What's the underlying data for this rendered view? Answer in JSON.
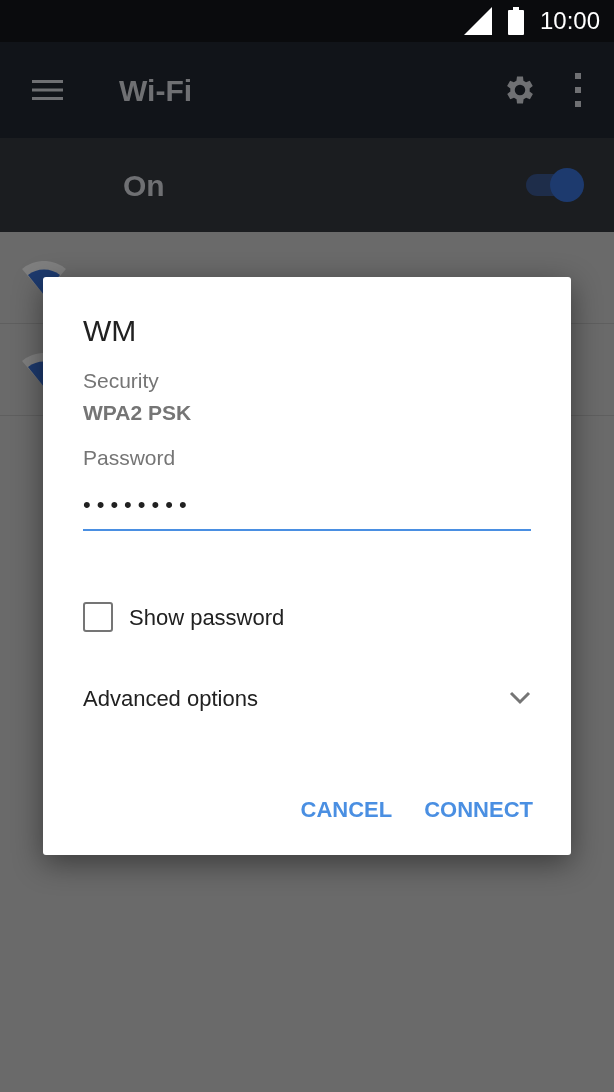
{
  "status_bar": {
    "time": "10:00"
  },
  "app_bar": {
    "title": "Wi-Fi"
  },
  "wifi_switch": {
    "label": "On",
    "on": true
  },
  "networks": [
    {
      "kind": "wifi"
    },
    {
      "kind": "wifi"
    }
  ],
  "dialog": {
    "title": "WM",
    "security_label": "Security",
    "security_value": "WPA2 PSK",
    "password_label": "Password",
    "password_value": "••••••••",
    "show_password": {
      "label": "Show password",
      "checked": false
    },
    "advanced_options": {
      "label": "Advanced options",
      "expanded": false
    },
    "buttons": [
      "CANCEL",
      "CONNECT"
    ]
  }
}
